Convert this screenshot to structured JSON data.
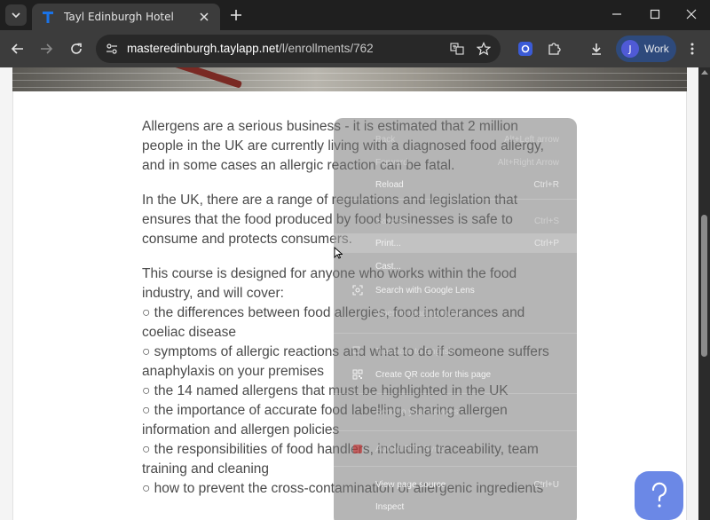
{
  "browser": {
    "tab_title": "Tayl Edinburgh Hotel",
    "url_host": "masteredinburgh.taylapp.net",
    "url_path": "/l/enrollments/762",
    "profile_initial": "J",
    "profile_label": "Work"
  },
  "article": {
    "paragraphs": [
      "Allergens are a serious business - it is estimated that 2 million people in the UK are currently living with a diagnosed food allergy, and in some cases an allergic reaction can be fatal.",
      "In the UK, there are a range of regulations and legislation that ensures that the food produced by food businesses is safe to consume and protects consumers."
    ],
    "intro": "This course is designed for anyone who works within the food industry, and will cover:",
    "bullets": [
      "○ the differences between food allergies, food intolerances and coeliac disease",
      "○ symptoms of allergic reactions and what to do if someone suffers anaphylaxis on your premises",
      "○ the 14 named allergens that must be highlighted in the UK",
      "○ the importance of accurate food labelling, sharing allergen information and allergen policies",
      "○ the responsibilities of food handlers, including traceability, team training and cleaning",
      "○ how to prevent the cross-contamination of allergenic ingredients"
    ]
  },
  "context_menu": {
    "back": {
      "label": "Back",
      "shortcut": "Alt+Left arrow"
    },
    "forward": {
      "label": "Forward",
      "shortcut": "Alt+Right Arrow"
    },
    "reload": {
      "label": "Reload",
      "shortcut": "Ctrl+R"
    },
    "save_as": {
      "label": "Save as...",
      "shortcut": "Ctrl+S"
    },
    "print": {
      "label": "Print...",
      "shortcut": "Ctrl+P"
    },
    "cast": {
      "label": "Cast..."
    },
    "lens": {
      "label": "Search with Google Lens"
    },
    "read_aloud": {
      "label": "Open in reading mode"
    },
    "translate": {
      "label": "Translate to English"
    },
    "qr": {
      "label": "Create QR code for this page"
    },
    "send_devices": {
      "label": "Send to your devices"
    },
    "pdf": {
      "label": "Add to PDF Sync"
    },
    "view_source": {
      "label": "View page source",
      "shortcut": "Ctrl+U"
    },
    "inspect": {
      "label": "Inspect"
    }
  },
  "colors": {
    "accent": "#6b88e6",
    "brand_logo": "#1a73e8"
  }
}
